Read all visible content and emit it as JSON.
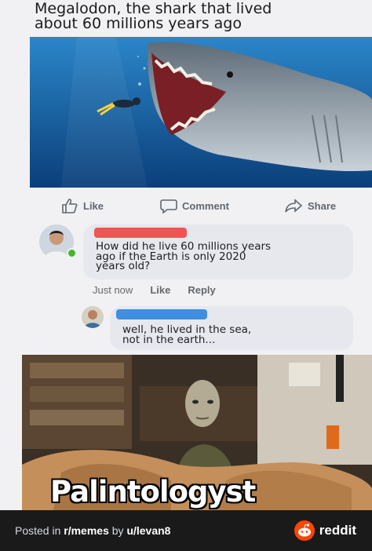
{
  "post": {
    "title_line1": "Megalodon, the shark that lived",
    "title_line2": "about 60 millions years ago"
  },
  "actions": {
    "like": "Like",
    "comment": "Comment",
    "share": "Share"
  },
  "comments": [
    {
      "text": "How did he live 60 millions years\nago if the Earth is only 2020\nyears old?",
      "time": "Just now",
      "like": "Like",
      "reply": "Reply"
    },
    {
      "text": "well, he lived in the sea,\nnot in the earth..."
    }
  ],
  "meme": {
    "caption": "Palintologyst"
  },
  "footer": {
    "posted_prefix": "Posted in ",
    "subreddit": "r/memes",
    "by": " by ",
    "user": "u/levan8",
    "brand": "reddit"
  },
  "colors": {
    "redaction_red": "#f05454",
    "redaction_blue": "#3f8fe0",
    "reddit_orange": "#ff4500",
    "online_green": "#42b72a"
  }
}
